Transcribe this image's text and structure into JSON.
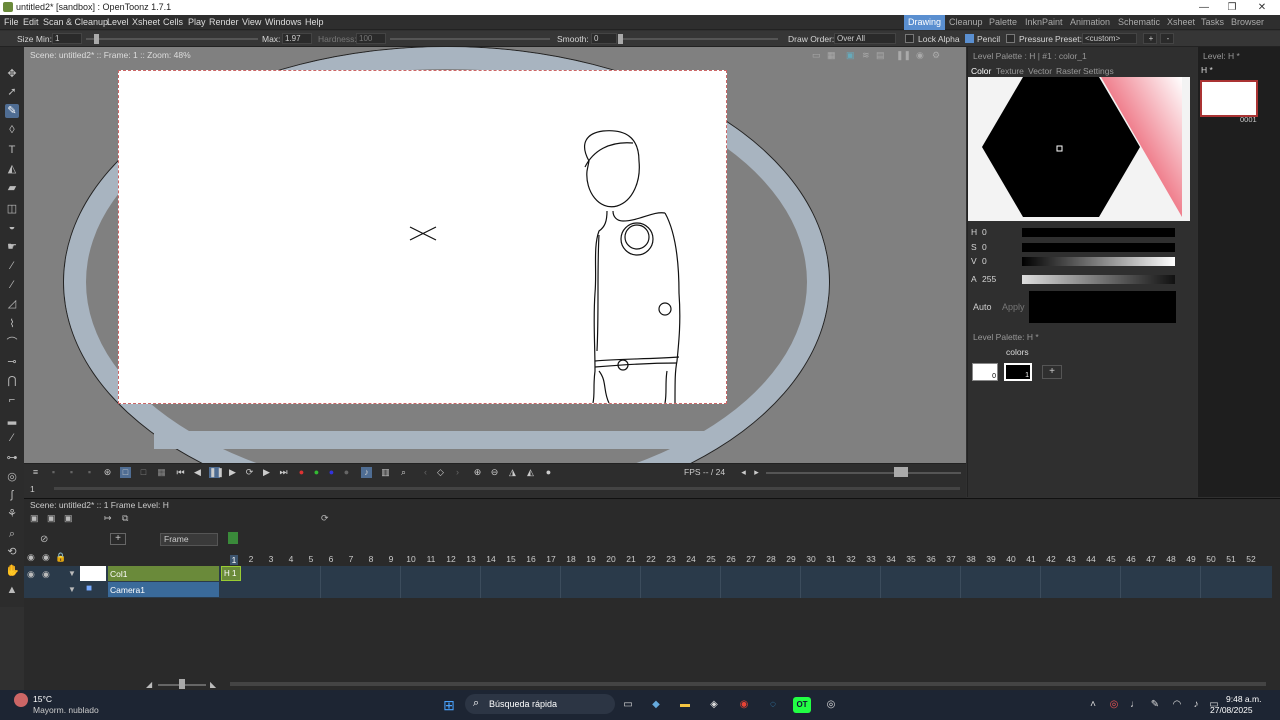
{
  "window": {
    "title": "untitled2* [sandbox] : OpenToonz 1.7.1",
    "min": "—",
    "max": "❐",
    "close": "✕"
  },
  "menu": [
    "File",
    "Edit",
    "Scan & Cleanup",
    "Level",
    "Xsheet",
    "Cells",
    "Play",
    "Render",
    "View",
    "Windows",
    "Help"
  ],
  "rooms": [
    "Drawing",
    "Cleanup",
    "Palette",
    "InknPaint",
    "Animation",
    "Schematic",
    "Xsheet",
    "Tasks",
    "Browser"
  ],
  "tool_options": {
    "size_min_label": "Size Min:",
    "size_min_value": "1",
    "max_label": "Max:",
    "max_value": "1.97",
    "hardness_label": "Hardness:",
    "hardness_value": "100",
    "smooth_label": "Smooth:",
    "smooth_value": "0",
    "draw_order_label": "Draw Order:",
    "draw_order_value": "Over All",
    "lock_alpha": "Lock Alpha",
    "pencil": "Pencil",
    "pressure": "Pressure",
    "preset_label": "Preset:",
    "preset_value": "<custom>",
    "plus": "+",
    "minus": "-"
  },
  "viewer": {
    "scene_info": "Scene: untitled2*  ::  Frame: 1  ::  Zoom: 48%",
    "fps_label": "FPS -- / 24",
    "current_frame": "1"
  },
  "level_palette": {
    "header": "Level Palette : H | #1 : color_1",
    "tabs": [
      "Color",
      "Texture",
      "Vector",
      "Raster",
      "Settings"
    ],
    "h_label": "H",
    "h_value": "0",
    "s_label": "S",
    "s_value": "0",
    "v_label": "V",
    "v_value": "0",
    "a_label": "A",
    "a_value": "255",
    "auto": "Auto",
    "apply": "Apply",
    "current_color": "#000000"
  },
  "palette_viewer": {
    "header": "Level Palette: H *",
    "page": "colors",
    "add": "+",
    "styles": [
      {
        "id": "0",
        "color": "#ffffff"
      },
      {
        "id": "1",
        "color": "#000000"
      }
    ]
  },
  "level_strip": {
    "header": "Level: H *",
    "name": "H *",
    "frame": "0001"
  },
  "xsheet": {
    "scene_info": "Scene: untitled2*  ::  1 Frame  Level: H",
    "frame_label": "Frame",
    "frames": [
      "2",
      "3",
      "4",
      "5",
      "6",
      "7",
      "8",
      "9",
      "10",
      "11",
      "12",
      "13",
      "14",
      "15",
      "16",
      "17",
      "18",
      "19",
      "20",
      "21",
      "22",
      "23",
      "24",
      "25",
      "26",
      "27",
      "28",
      "29",
      "30",
      "31",
      "32",
      "33",
      "34",
      "35",
      "36",
      "37",
      "38",
      "39",
      "40",
      "41",
      "42",
      "43",
      "44",
      "45",
      "46",
      "47",
      "48",
      "49",
      "50",
      "51",
      "52"
    ],
    "current_frame": "1",
    "columns": [
      {
        "name": "Col1",
        "cell": "H 1"
      },
      {
        "name": "Camera1"
      }
    ]
  },
  "taskbar": {
    "temperature": "15°C",
    "weather": "Mayorm. nublado",
    "search": "Búsqueda rápida",
    "time": "9:48 a.m.",
    "date": "27/08/2025"
  }
}
